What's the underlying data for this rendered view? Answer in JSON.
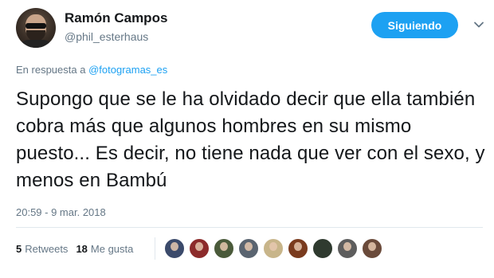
{
  "tweet": {
    "display_name": "Ramón Campos",
    "username": "@phil_esterhaus",
    "follow_label": "Siguiendo",
    "reply_prefix": "En respuesta a",
    "reply_mention": "@fotogramas_es",
    "text": "Supongo que se le ha olvidado decir que ella también cobra más que algunos hombres en su mismo puesto... Es decir, no tiene nada que ver con el sexo, y menos en Bambú",
    "timestamp": "20:59 - 9 mar. 2018",
    "retweets_count": "5",
    "retweets_label": "Retweets",
    "likes_count": "18",
    "likes_label": "Me gusta"
  },
  "icons": {
    "caret": "chevron-down-icon",
    "avatar": "avatar"
  },
  "colors": {
    "accent": "#1da1f2",
    "text": "#14171a",
    "muted": "#657786",
    "divider": "#e1e8ed"
  },
  "likers": [
    {
      "color": "#3b4a6b"
    },
    {
      "color": "#8c2b2b"
    },
    {
      "color": "#4a5a3a"
    },
    {
      "color": "#5a6470"
    },
    {
      "color": "#c8b58a"
    },
    {
      "color": "#7a3b1e"
    },
    {
      "color": "#2f3a2f"
    },
    {
      "color": "#5d5d5d"
    },
    {
      "color": "#6a4a3a"
    }
  ]
}
